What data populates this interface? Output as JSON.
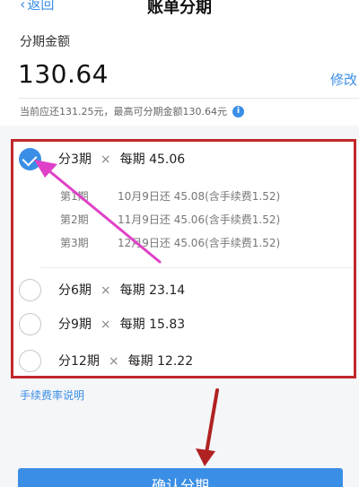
{
  "header": {
    "back_label": "返回",
    "title": "账单分期"
  },
  "amount": {
    "label": "分期金额",
    "value": "130.64",
    "modify_label": "修改",
    "hint": "当前应还131.25元，最高可分期金额130.64元",
    "info_icon": "i"
  },
  "plans": [
    {
      "label": "分3期",
      "per_label": "每期",
      "per_amount": "45.06",
      "selected": true,
      "schedule": [
        {
          "period": "第1期",
          "text": "10月9日还 45.08(含手续费1.52)"
        },
        {
          "period": "第2期",
          "text": "11月9日还 45.06(含手续费1.52)"
        },
        {
          "period": "第3期",
          "text": "12月9日还 45.06(含手续费1.52)"
        }
      ]
    },
    {
      "label": "分6期",
      "per_label": "每期",
      "per_amount": "23.14",
      "selected": false
    },
    {
      "label": "分9期",
      "per_label": "每期",
      "per_amount": "15.83",
      "selected": false
    },
    {
      "label": "分12期",
      "per_label": "每期",
      "per_amount": "12.22",
      "selected": false
    }
  ],
  "fee_link": "手续费率说明",
  "confirm_label": "确认分期",
  "colors": {
    "accent": "#3a8ee6",
    "highlight_box": "#c0282b",
    "arrow_pink": "#e040c8",
    "arrow_red": "#b02222"
  }
}
